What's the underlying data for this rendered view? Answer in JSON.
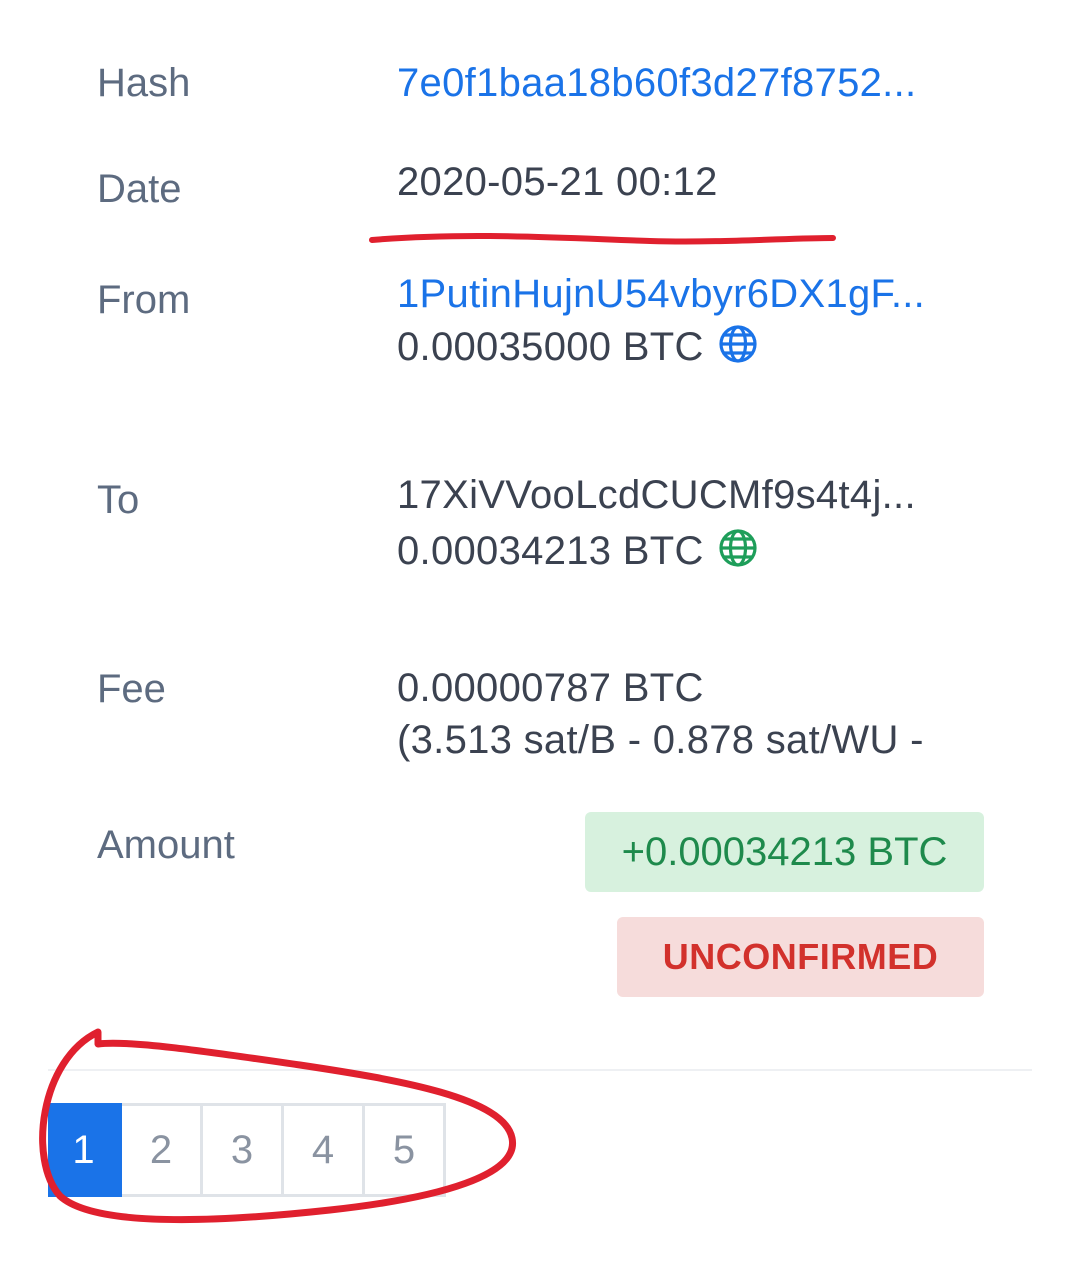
{
  "rows": {
    "hash": {
      "label": "Hash",
      "value": "7e0f1baa18b60f3d27f8752..."
    },
    "date": {
      "label": "Date",
      "value": "2020-05-21 00:12"
    },
    "from": {
      "label": "From",
      "address": "1PutinHujnU54vbyr6DX1gF...",
      "amount": "0.00035000 BTC"
    },
    "to": {
      "label": "To",
      "address": "17XiVVooLcdCUCMf9s4t4j...",
      "amount": "0.00034213 BTC"
    },
    "fee": {
      "label": "Fee",
      "amount": "0.00000787 BTC",
      "rate": "(3.513 sat/B - 0.878 sat/WU -"
    },
    "amount": {
      "label": "Amount",
      "value": "+0.00034213 BTC",
      "status": "UNCONFIRMED"
    }
  },
  "pagination": {
    "pages": [
      "1",
      "2",
      "3",
      "4",
      "5"
    ],
    "active": "1"
  },
  "icons": {
    "from_globe": "globe-icon",
    "to_globe": "globe-icon"
  },
  "colors": {
    "link": "#1a73e8",
    "from_globe": "#1a73e8",
    "to_globe": "#1e9e5a",
    "amount_bg": "#d7f1de",
    "amount_text": "#1e8a4c",
    "status_bg": "#f6dcdb",
    "status_text": "#d2312c",
    "annotation": "#e0202e"
  }
}
